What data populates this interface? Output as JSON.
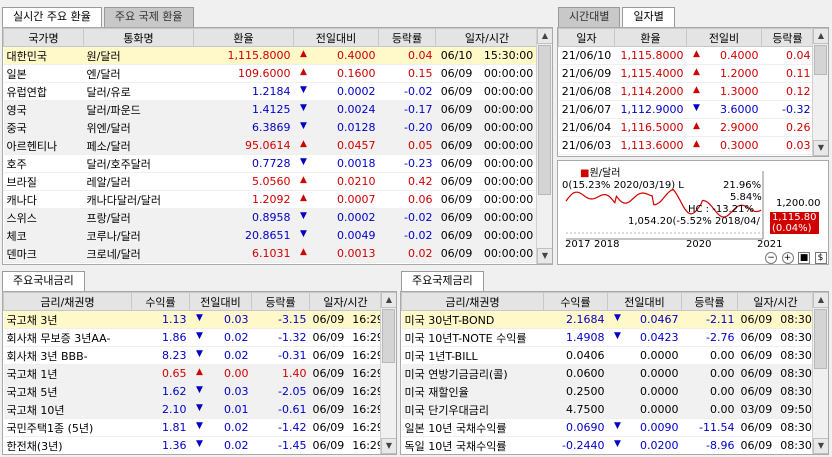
{
  "fx_tabs": [
    "실시간 주요 환율",
    "주요 국제 환율"
  ],
  "fx_headers": [
    "국가명",
    "통화명",
    "환율",
    "전일대비",
    "등락률",
    "일자/시간"
  ],
  "fx_rows": [
    {
      "country": "대한민국",
      "currency": "원/달러",
      "rate": "1,115.8000",
      "dir": "up",
      "change": "0.4000",
      "pct": "0.04",
      "date": "06/10",
      "time": "15:30:00"
    },
    {
      "country": "일본",
      "currency": "엔/달러",
      "rate": "109.6000",
      "dir": "up",
      "change": "0.1600",
      "pct": "0.15",
      "date": "06/09",
      "time": "00:00:00"
    },
    {
      "country": "유럽연합",
      "currency": "달러/유로",
      "rate": "1.2184",
      "dir": "down",
      "change": "0.0002",
      "pct": "-0.02",
      "date": "06/09",
      "time": "00:00:00"
    },
    {
      "country": "영국",
      "currency": "달러/파운드",
      "rate": "1.4125",
      "dir": "down",
      "change": "0.0024",
      "pct": "-0.17",
      "date": "06/09",
      "time": "00:00:00"
    },
    {
      "country": "중국",
      "currency": "위엔/달러",
      "rate": "6.3869",
      "dir": "down",
      "change": "0.0128",
      "pct": "-0.20",
      "date": "06/09",
      "time": "00:00:00"
    },
    {
      "country": "아르헨티나",
      "currency": "페소/달러",
      "rate": "95.0614",
      "dir": "up",
      "change": "0.0457",
      "pct": "0.05",
      "date": "06/09",
      "time": "00:00:00"
    },
    {
      "country": "호주",
      "currency": "달러/호주달러",
      "rate": "0.7728",
      "dir": "down",
      "change": "0.0018",
      "pct": "-0.23",
      "date": "06/09",
      "time": "00:00:00"
    },
    {
      "country": "브라질",
      "currency": "레알/달러",
      "rate": "5.0560",
      "dir": "up",
      "change": "0.0210",
      "pct": "0.42",
      "date": "06/09",
      "time": "00:00:00"
    },
    {
      "country": "캐나다",
      "currency": "캐나다달러/달러",
      "rate": "1.2092",
      "dir": "up",
      "change": "0.0007",
      "pct": "0.06",
      "date": "06/09",
      "time": "00:00:00"
    },
    {
      "country": "스위스",
      "currency": "프랑/달러",
      "rate": "0.8958",
      "dir": "down",
      "change": "0.0002",
      "pct": "-0.02",
      "date": "06/09",
      "time": "00:00:00"
    },
    {
      "country": "체코",
      "currency": "코루나/달러",
      "rate": "20.8651",
      "dir": "down",
      "change": "0.0049",
      "pct": "-0.02",
      "date": "06/09",
      "time": "00:00:00"
    },
    {
      "country": "덴마크",
      "currency": "크로네/달러",
      "rate": "6.1031",
      "dir": "up",
      "change": "0.0013",
      "pct": "0.02",
      "date": "06/09",
      "time": "00:00:00"
    }
  ],
  "hist_tabs": [
    "시간대별",
    "일자별"
  ],
  "hist_headers": [
    "일자",
    "환율",
    "전일비",
    "등락률"
  ],
  "hist_rows": [
    {
      "date": "21/06/10",
      "rate": "1,115.8000",
      "dir": "up",
      "change": "0.4000",
      "pct": "0.04"
    },
    {
      "date": "21/06/09",
      "rate": "1,115.4000",
      "dir": "up",
      "change": "1.2000",
      "pct": "0.11"
    },
    {
      "date": "21/06/08",
      "rate": "1,114.2000",
      "dir": "up",
      "change": "1.3000",
      "pct": "0.12"
    },
    {
      "date": "21/06/07",
      "rate": "1,112.9000",
      "dir": "down",
      "change": "3.6000",
      "pct": "-0.32"
    },
    {
      "date": "21/06/04",
      "rate": "1,116.5000",
      "dir": "up",
      "change": "2.9000",
      "pct": "0.26"
    },
    {
      "date": "21/06/03",
      "rate": "1,113.6000",
      "dir": "up",
      "change": "0.3000",
      "pct": "0.03"
    }
  ],
  "chart": {
    "legend": "원/달러",
    "low_note": "0(15.23% 2020/03/19) L",
    "pct_high": "21.96%",
    "pct_mid": "5.84%",
    "hc_note": "HC : -13.21%",
    "low_value_note": "1,054.20(-5.52% 2018/04/",
    "right_axis": "1,200.00",
    "current_value": "1,115.80",
    "current_pct": "(0.04%)",
    "x_ticks": [
      "2017",
      "2018",
      "2020",
      "2021"
    ],
    "line_color": "#d00000",
    "controls": [
      "−",
      "+",
      "■",
      "$"
    ]
  },
  "domestic_tab": "주요국내금리",
  "domestic_headers": [
    "금리/채권명",
    "수익률",
    "전일대비",
    "등락률",
    "일자/시간"
  ],
  "domestic_rows": [
    {
      "name": "국고채 3년",
      "yield": "1.13",
      "dir": "down",
      "change": "0.03",
      "pct": "-3.15",
      "date": "06/09",
      "time": "16:29"
    },
    {
      "name": "회사채 무보증 3년AA-",
      "yield": "1.86",
      "dir": "down",
      "change": "0.02",
      "pct": "-1.32",
      "date": "06/09",
      "time": "16:29"
    },
    {
      "name": "회사채 3년 BBB-",
      "yield": "8.23",
      "dir": "down",
      "change": "0.02",
      "pct": "-0.31",
      "date": "06/09",
      "time": "16:29"
    },
    {
      "name": "국고채 1년",
      "yield": "0.65",
      "dir": "up",
      "change": "0.00",
      "pct": "1.40",
      "date": "06/09",
      "time": "16:29"
    },
    {
      "name": "국고채 5년",
      "yield": "1.62",
      "dir": "down",
      "change": "0.03",
      "pct": "-2.05",
      "date": "06/09",
      "time": "16:29"
    },
    {
      "name": "국고채 10년",
      "yield": "2.10",
      "dir": "down",
      "change": "0.01",
      "pct": "-0.61",
      "date": "06/09",
      "time": "16:29"
    },
    {
      "name": "국민주택1종 (5년)",
      "yield": "1.81",
      "dir": "down",
      "change": "0.02",
      "pct": "-1.42",
      "date": "06/09",
      "time": "16:29"
    },
    {
      "name": "한전채(3년)",
      "yield": "1.36",
      "dir": "down",
      "change": "0.02",
      "pct": "-1.45",
      "date": "06/09",
      "time": "16:29"
    }
  ],
  "intl_tab": "주요국제금리",
  "intl_headers": [
    "금리/채권명",
    "수익률",
    "전일대비",
    "등락률",
    "일자/시간"
  ],
  "intl_rows": [
    {
      "name": "미국 30년T-BOND",
      "yield": "2.1684",
      "dir": "down",
      "change": "0.0467",
      "pct": "-2.11",
      "date": "06/09",
      "time": "08:30"
    },
    {
      "name": "미국 10년T-NOTE 수익률",
      "yield": "1.4908",
      "dir": "down",
      "change": "0.0423",
      "pct": "-2.76",
      "date": "06/09",
      "time": "08:30"
    },
    {
      "name": "미국 1년T-BILL",
      "yield": "0.0406",
      "dir": "none",
      "change": "0.0000",
      "pct": "0.00",
      "date": "06/09",
      "time": "08:30"
    },
    {
      "name": "미국 연방기금금리(콜)",
      "yield": "0.0600",
      "dir": "none",
      "change": "0.0000",
      "pct": "0.00",
      "date": "06/09",
      "time": "08:30"
    },
    {
      "name": "미국 재할인율",
      "yield": "0.2500",
      "dir": "none",
      "change": "0.0000",
      "pct": "0.00",
      "date": "06/09",
      "time": "08:30"
    },
    {
      "name": "미국 단기우대금리",
      "yield": "4.7500",
      "dir": "none",
      "change": "0.0000",
      "pct": "0.00",
      "date": "03/09",
      "time": "09:50"
    },
    {
      "name": "일본 10년 국채수익률",
      "yield": "0.0690",
      "dir": "down",
      "change": "0.0090",
      "pct": "-11.54",
      "date": "06/09",
      "time": "08:30"
    },
    {
      "name": "독일 10년 국채수익률",
      "yield": "-0.2440",
      "dir": "down",
      "change": "0.0200",
      "pct": "-8.96",
      "date": "06/09",
      "time": "08:30"
    }
  ]
}
